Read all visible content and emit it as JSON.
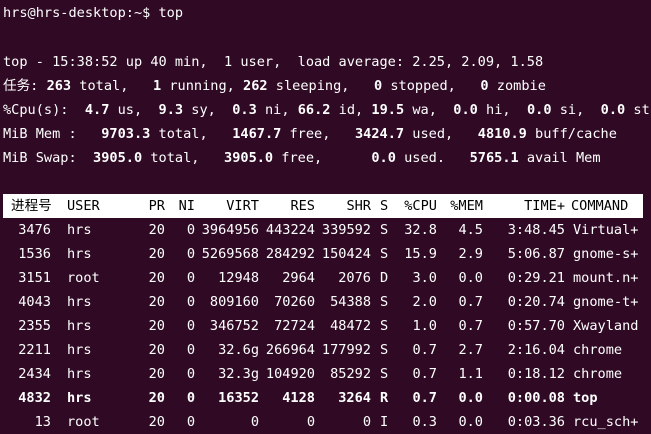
{
  "prompt": {
    "text": "hrs@hrs-desktop:~$ top"
  },
  "summary": {
    "line1": "top - 15:38:52 up 40 min,  1 user,  load average: 2.25, 2.09, 1.58",
    "tasks": {
      "label": "任务:",
      "total": "263",
      "total_t": " total,",
      "running": "1",
      "running_t": " running,",
      "sleeping": "262",
      "sleeping_t": " sleeping,",
      "stopped": "0",
      "stopped_t": " stopped,",
      "zombie": "0",
      "zombie_t": " zombie"
    },
    "cpu": {
      "label": "%Cpu(s):",
      "us": "4.7",
      "us_t": " us,",
      "sy": "9.3",
      "sy_t": " sy,",
      "ni": "0.3",
      "ni_t": " ni,",
      "id": "66.2",
      "id_t": " id,",
      "wa": "19.5",
      "wa_t": " wa,",
      "hi": "0.0",
      "hi_t": " hi,",
      "si": "0.0",
      "si_t": " si,",
      "st": "0.0",
      "st_t": " st"
    },
    "mem": {
      "label": "MiB Mem :",
      "total": "9703.3",
      "total_t": " total,",
      "free": "1467.7",
      "free_t": " free,",
      "used": "3424.7",
      "used_t": " used,",
      "cache": "4810.9",
      "cache_t": " buff/cache"
    },
    "swap": {
      "label": "MiB Swap:",
      "total": "3905.0",
      "total_t": " total,",
      "free": "3905.0",
      "free_t": " free,",
      "used": "0.0",
      "used_t": " used.",
      "avail": "5765.1",
      "avail_t": " avail Mem"
    }
  },
  "table": {
    "headers": {
      "pid": "进程号",
      "user": "USER",
      "pr": "PR",
      "ni": "NI",
      "virt": "VIRT",
      "res": "RES",
      "shr": "SHR",
      "s": "S",
      "cpu": "%CPU",
      "mem": "%MEM",
      "time": "TIME+",
      "command": "COMMAND"
    },
    "rows": [
      {
        "pid": "3476",
        "user": "hrs",
        "pr": "20",
        "ni": "0",
        "virt": "3964956",
        "res": "443224",
        "shr": "339592",
        "s": "S",
        "cpu": "32.8",
        "mem": "4.5",
        "time": "3:48.45",
        "command": "Virtual+",
        "bold": false
      },
      {
        "pid": "1536",
        "user": "hrs",
        "pr": "20",
        "ni": "0",
        "virt": "5269568",
        "res": "284292",
        "shr": "150424",
        "s": "S",
        "cpu": "15.9",
        "mem": "2.9",
        "time": "5:06.87",
        "command": "gnome-s+",
        "bold": false
      },
      {
        "pid": "3151",
        "user": "root",
        "pr": "20",
        "ni": "0",
        "virt": "12948",
        "res": "2964",
        "shr": "2076",
        "s": "D",
        "cpu": "3.0",
        "mem": "0.0",
        "time": "0:29.21",
        "command": "mount.n+",
        "bold": false
      },
      {
        "pid": "4043",
        "user": "hrs",
        "pr": "20",
        "ni": "0",
        "virt": "809160",
        "res": "70260",
        "shr": "54388",
        "s": "S",
        "cpu": "2.0",
        "mem": "0.7",
        "time": "0:20.74",
        "command": "gnome-t+",
        "bold": false
      },
      {
        "pid": "2355",
        "user": "hrs",
        "pr": "20",
        "ni": "0",
        "virt": "346752",
        "res": "72724",
        "shr": "48472",
        "s": "S",
        "cpu": "1.0",
        "mem": "0.7",
        "time": "0:57.70",
        "command": "Xwayland",
        "bold": false
      },
      {
        "pid": "2211",
        "user": "hrs",
        "pr": "20",
        "ni": "0",
        "virt": "32.6g",
        "res": "266964",
        "shr": "177992",
        "s": "S",
        "cpu": "0.7",
        "mem": "2.7",
        "time": "2:16.04",
        "command": "chrome",
        "bold": false
      },
      {
        "pid": "2434",
        "user": "hrs",
        "pr": "20",
        "ni": "0",
        "virt": "32.3g",
        "res": "104920",
        "shr": "85292",
        "s": "S",
        "cpu": "0.7",
        "mem": "1.1",
        "time": "0:18.12",
        "command": "chrome",
        "bold": false
      },
      {
        "pid": "4832",
        "user": "hrs",
        "pr": "20",
        "ni": "0",
        "virt": "16352",
        "res": "4128",
        "shr": "3264",
        "s": "R",
        "cpu": "0.7",
        "mem": "0.0",
        "time": "0:00.08",
        "command": "top",
        "bold": true
      },
      {
        "pid": "13",
        "user": "root",
        "pr": "20",
        "ni": "0",
        "virt": "0",
        "res": "0",
        "shr": "0",
        "s": "I",
        "cpu": "0.3",
        "mem": "0.0",
        "time": "0:03.36",
        "command": "rcu_sch+",
        "bold": false
      }
    ]
  }
}
